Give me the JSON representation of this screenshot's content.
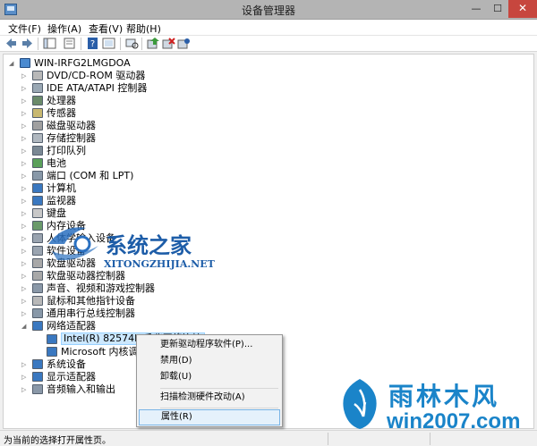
{
  "window": {
    "title": "设备管理器",
    "minimize": "—",
    "maximize": "☐",
    "close": "✕"
  },
  "menu": [
    "文件(F)",
    "操作(A)",
    "查看(V)",
    "帮助(H)"
  ],
  "tree": {
    "root": "WIN-IRFG2LMGDOA",
    "categories": [
      "DVD/CD-ROM 驱动器",
      "IDE ATA/ATAPI 控制器",
      "处理器",
      "传感器",
      "磁盘驱动器",
      "存储控制器",
      "打印队列",
      "电池",
      "端口 (COM 和 LPT)",
      "计算机",
      "监视器",
      "键盘",
      "内存设备",
      "人体学输入设备",
      "软件设备",
      "软盘驱动器",
      "软盘驱动器控制器",
      "声音、视频和游戏控制器",
      "鼠标和其他指针设备",
      "通用串行总线控制器",
      "网络适配器"
    ],
    "network_children": [
      "Intel(R) 82574L 千兆网络连接",
      "Microsoft 内核调试"
    ],
    "after": [
      "系统设备",
      "显示适配器",
      "音频输入和输出"
    ]
  },
  "context_menu": {
    "items": [
      "更新驱动程序软件(P)...",
      "禁用(D)",
      "卸载(U)",
      "扫描检测硬件改动(A)",
      "属性(R)"
    ]
  },
  "status": {
    "text": "为当前的选择打开属性页。"
  },
  "watermarks": {
    "center_cn": "系统之家",
    "center_en": "XITONGZHIJIA.NET",
    "corner_cn": "雨林木风",
    "corner_en": "win2007.com"
  },
  "colors": {
    "selection": "#cce8ff",
    "close_button": "#c7463e",
    "watermark": "#1a84c9"
  }
}
